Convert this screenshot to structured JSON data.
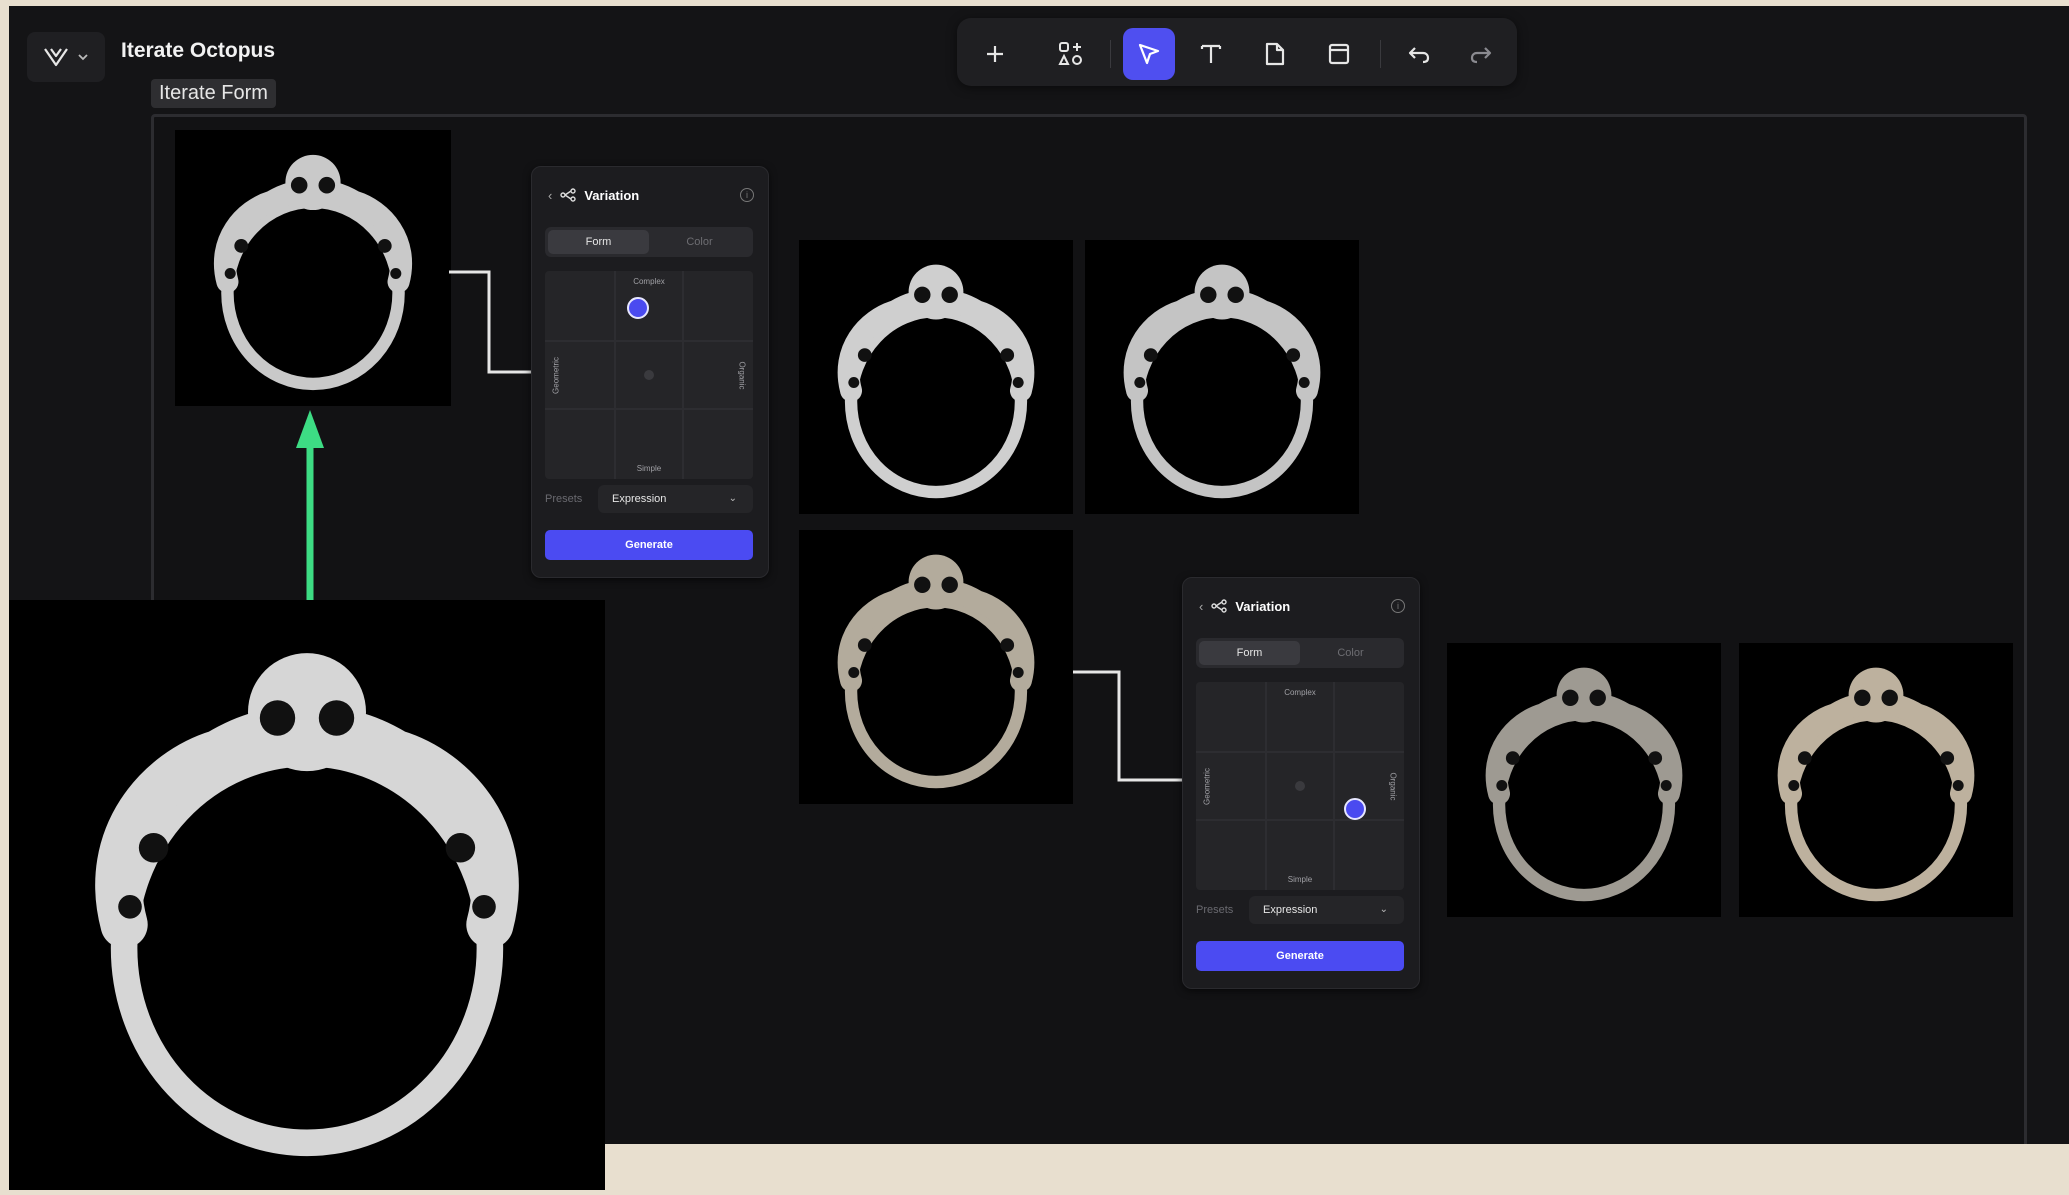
{
  "project": {
    "title": "Iterate Octopus"
  },
  "frame": {
    "label": "Iterate Form"
  },
  "toolbar": {
    "tools": [
      "add",
      "components",
      "select",
      "text",
      "page",
      "frame",
      "undo",
      "redo"
    ],
    "active_tool": "select",
    "accent": "#4f4ff0"
  },
  "panels": [
    {
      "title": "Variation",
      "tabs": [
        "Form",
        "Color"
      ],
      "active_tab": "Form",
      "axes": {
        "top": "Complex",
        "bottom": "Simple",
        "left": "Geometric",
        "right": "Organic"
      },
      "presets_label": "Presets",
      "preset_value": "Expression",
      "generate_label": "Generate"
    },
    {
      "title": "Variation",
      "tabs": [
        "Form",
        "Color"
      ],
      "active_tab": "Form",
      "axes": {
        "top": "Complex",
        "bottom": "Simple",
        "left": "Geometric",
        "right": "Organic"
      },
      "presets_label": "Presets",
      "preset_value": "Expression",
      "generate_label": "Generate"
    }
  ],
  "colors": {
    "arrow": "#3ddc84",
    "generate": "#4b4bf2",
    "background": "#141416"
  }
}
